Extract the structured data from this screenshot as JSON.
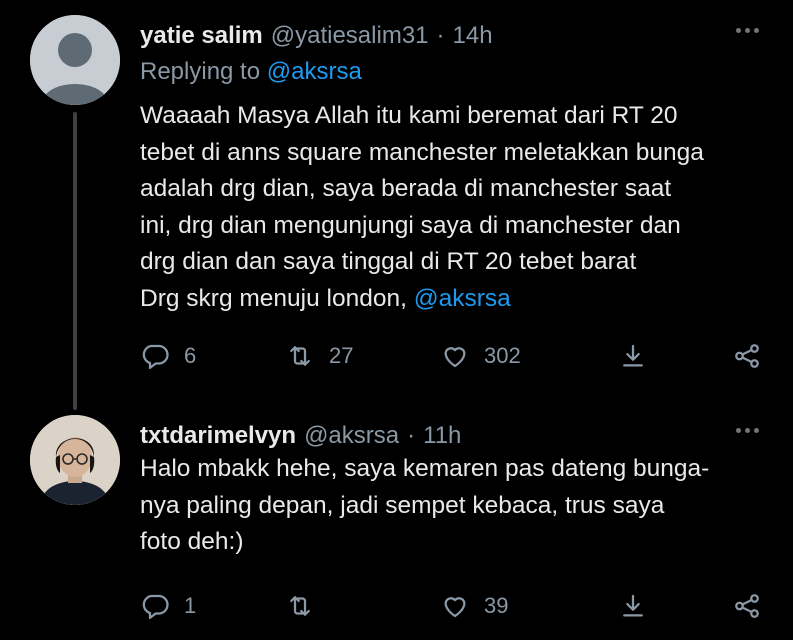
{
  "tweets": [
    {
      "name": "yatie salim",
      "handle": "@yatiesalim31",
      "separator": "·",
      "time": "14h",
      "reply_prefix": "Replying to",
      "reply_handle": "@aksrsa",
      "body_lines": [
        "Waaaah Masya Allah itu kami beremat dari RT 20",
        "tebet di anns square manchester meletakkan bunga",
        "adalah drg dian, saya berada di manchester saat",
        "ini, drg dian mengunjungi saya di manchester dan",
        "drg dian dan saya tinggal di RT 20 tebet barat",
        "Drg skrg menuju london, "
      ],
      "body_mention": "@aksrsa",
      "replies": "6",
      "retweets": "27",
      "likes": "302"
    },
    {
      "name": "txtdarimelvyn",
      "handle": "@aksrsa",
      "separator": "·",
      "time": "11h",
      "body_lines": [
        "Halo mbakk hehe, saya kemaren pas dateng bunga-",
        "nya paling depan, jadi sempet kebaca, trus saya",
        "foto deh:)"
      ],
      "replies": "1",
      "retweets": "",
      "likes": "39"
    }
  ],
  "icons": {
    "reply": "speech-bubble-icon",
    "retweet": "retweet-icon",
    "like": "heart-icon",
    "share": "download-arrow-icon",
    "menu": "share-nodes-icon",
    "more": "three-dots-icon"
  },
  "colors": {
    "background": "#000000",
    "text": "#e7e9ea",
    "secondary": "#8b98a5",
    "accent": "#1d9bf0"
  }
}
